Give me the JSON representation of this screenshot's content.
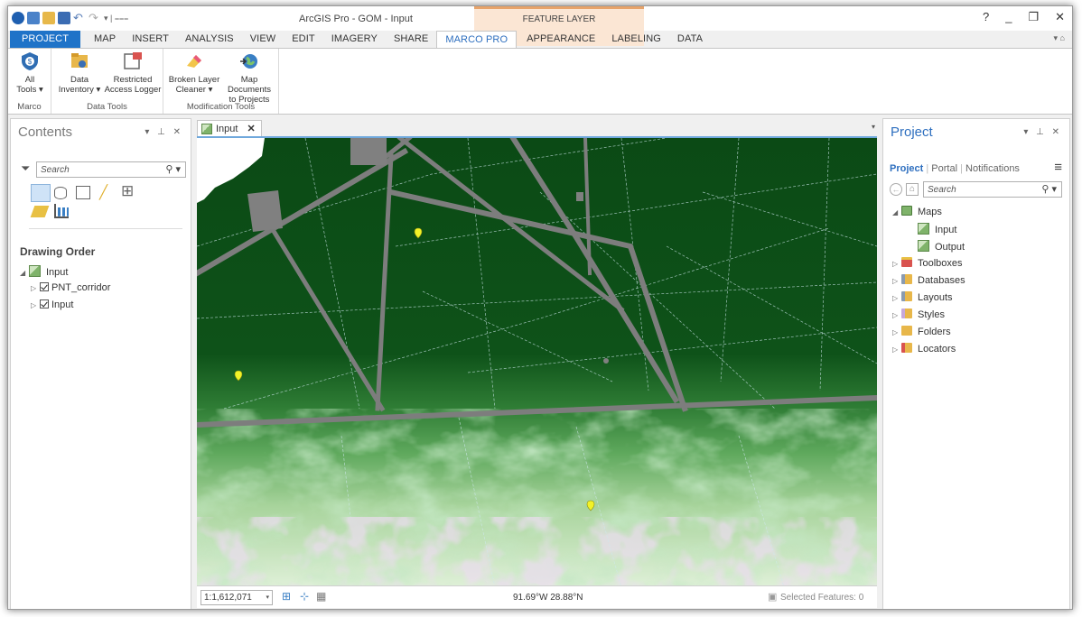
{
  "title_bar": {
    "app_title": "ArcGIS Pro - GOM - Input",
    "contextual_tab_group": "FEATURE LAYER",
    "window_controls": [
      "?",
      "_",
      "❐",
      "✕"
    ]
  },
  "ribbon_tabs": [
    "PROJECT",
    "MAP",
    "INSERT",
    "ANALYSIS",
    "VIEW",
    "EDIT",
    "IMAGERY",
    "SHARE",
    "MARCO PRO",
    "APPEARANCE",
    "LABELING",
    "DATA"
  ],
  "active_tab": "MARCO PRO",
  "ribbon": {
    "groups": [
      {
        "label": "Marco",
        "buttons": [
          {
            "line1": "All",
            "line2": "Tools ▾",
            "icon": "marco-icon"
          }
        ]
      },
      {
        "label": "Data Tools",
        "buttons": [
          {
            "line1": "Data",
            "line2": "Inventory ▾",
            "icon": "data-inventory-icon"
          },
          {
            "line1": "Restricted",
            "line2": "Access Logger",
            "icon": "access-logger-icon"
          }
        ]
      },
      {
        "label": "Modification Tools",
        "buttons": [
          {
            "line1": "Broken Layer",
            "line2": "Cleaner ▾",
            "icon": "eraser-icon"
          },
          {
            "line1": "Map Documents",
            "line2": "to Projects",
            "icon": "globe-icon"
          }
        ]
      }
    ]
  },
  "contents_pane": {
    "title": "Contents",
    "controls": "▾ ⊥ ✕",
    "search_placeholder": "Search",
    "section_title": "Drawing Order",
    "map_name": "Input",
    "layers": [
      "PNT_corridor",
      "Input"
    ]
  },
  "map_view": {
    "tab_label": "Input",
    "scale": "1:1,612,071",
    "coordinates": "91.69°W 28.88°N",
    "selected_features": "Selected Features: 0"
  },
  "project_pane": {
    "title": "Project",
    "controls": "▾ ⊥ ✕",
    "tabs": [
      "Project",
      "Portal",
      "Notifications"
    ],
    "search_placeholder": "Search",
    "tree": {
      "maps_label": "Maps",
      "maps": [
        "Input",
        "Output"
      ],
      "folders": [
        "Toolboxes",
        "Databases",
        "Layouts",
        "Styles",
        "Folders",
        "Locators"
      ]
    }
  },
  "colors": {
    "project_tab": "#1f73c8",
    "accent_blue": "#2e6fbf",
    "contextual_group": "#fbe6d4",
    "map_dark_green": "#0d4a16",
    "corridor_gray": "#7d7d7d"
  }
}
